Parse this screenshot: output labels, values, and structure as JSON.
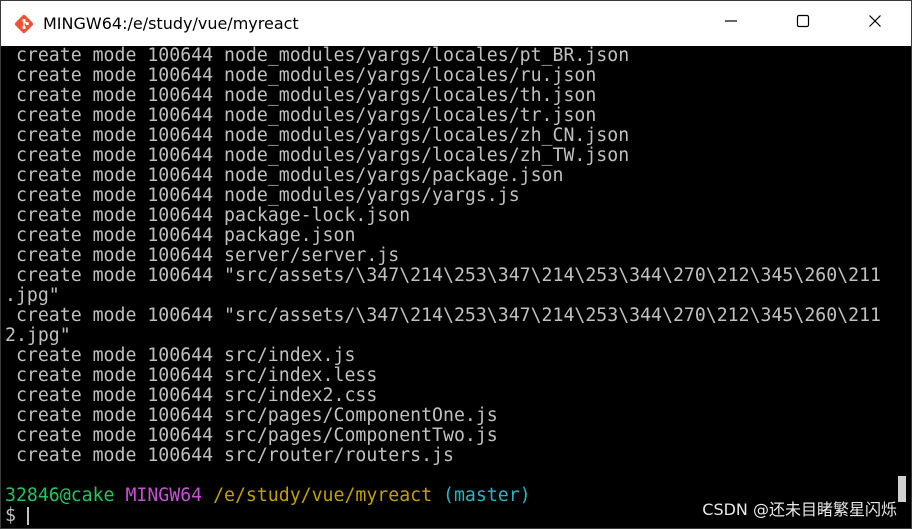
{
  "window": {
    "title": "MINGW64:/e/study/vue/myreact",
    "icon": "git-diamond-icon",
    "controls": [
      "minimize-icon",
      "maximize-icon",
      "close-icon"
    ]
  },
  "terminal": {
    "lines": [
      " create mode 100644 node_modules/yargs/locales/pt_BR.json",
      " create mode 100644 node_modules/yargs/locales/ru.json",
      " create mode 100644 node_modules/yargs/locales/th.json",
      " create mode 100644 node_modules/yargs/locales/tr.json",
      " create mode 100644 node_modules/yargs/locales/zh_CN.json",
      " create mode 100644 node_modules/yargs/locales/zh_TW.json",
      " create mode 100644 node_modules/yargs/package.json",
      " create mode 100644 node_modules/yargs/yargs.js",
      " create mode 100644 package-lock.json",
      " create mode 100644 package.json",
      " create mode 100644 server/server.js",
      " create mode 100644 \"src/assets/\\347\\214\\253\\347\\214\\253\\344\\270\\212\\345\\260\\211",
      ".jpg\"",
      " create mode 100644 \"src/assets/\\347\\214\\253\\347\\214\\253\\344\\270\\212\\345\\260\\211",
      "2.jpg\"",
      " create mode 100644 src/index.js",
      " create mode 100644 src/index.less",
      " create mode 100644 src/index2.css",
      " create mode 100644 src/pages/ComponentOne.js",
      " create mode 100644 src/pages/ComponentTwo.js",
      " create mode 100644 src/router/routers.js",
      ""
    ],
    "prompt": {
      "user_host": "32846@cake",
      "system": "MINGW64",
      "path": "/e/study/vue/myreact",
      "branch": "(master)"
    },
    "input_symbol": "$",
    "colors": {
      "text": "#c0c0c0",
      "user_host": "#23c45e",
      "system": "#c84fd6",
      "path": "#c2a000",
      "branch": "#26b5c8"
    }
  },
  "watermark": "CSDN @还未目睹繁星闪烁"
}
